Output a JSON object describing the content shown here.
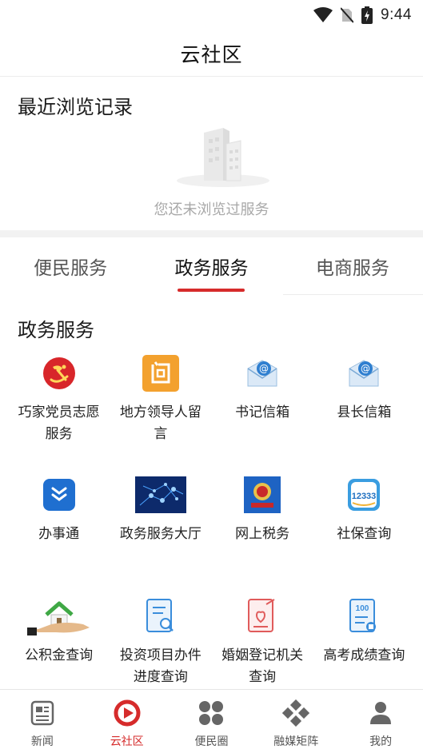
{
  "status_bar": {
    "time": "9:44"
  },
  "header": {
    "title": "云社区"
  },
  "recent": {
    "title": "最近浏览记录",
    "empty_text": "您还未浏览过服务"
  },
  "tabs": [
    {
      "label": "便民服务",
      "active": false
    },
    {
      "label": "政务服务",
      "active": true
    },
    {
      "label": "电商服务",
      "active": false
    }
  ],
  "gov": {
    "title": "政务服务",
    "items": [
      {
        "label": "巧家党员志愿服务",
        "icon": "party-emblem-icon"
      },
      {
        "label": "地方领导人留言",
        "icon": "question-char-icon"
      },
      {
        "label": "书记信箱",
        "icon": "email-envelope-icon"
      },
      {
        "label": "县长信箱",
        "icon": "email-envelope-icon"
      },
      {
        "label": "办事通",
        "icon": "banshitong-logo-icon"
      },
      {
        "label": "政务服务大厅",
        "icon": "network-hall-icon"
      },
      {
        "label": "网上税务",
        "icon": "tax-emblem-icon"
      },
      {
        "label": "社保查询",
        "icon": "social-security-12333-icon"
      },
      {
        "label": "公积金查询",
        "icon": "house-in-hand-icon"
      },
      {
        "label": "投资项目办件进度查询",
        "icon": "document-search-icon"
      },
      {
        "label": "婚姻登记机关查询",
        "icon": "marriage-document-icon"
      },
      {
        "label": "高考成绩查询",
        "icon": "exam-score-100-icon"
      }
    ]
  },
  "bottom_nav": [
    {
      "label": "新闻",
      "icon": "newspaper-icon",
      "active": false
    },
    {
      "label": "云社区",
      "icon": "play-circle-icon",
      "active": true
    },
    {
      "label": "便民圈",
      "icon": "four-petal-icon",
      "active": false
    },
    {
      "label": "融媒矩阵",
      "icon": "diamond-grid-icon",
      "active": false
    },
    {
      "label": "我的",
      "icon": "person-icon",
      "active": false
    }
  ],
  "colors": {
    "accent": "#d62b2b",
    "muted_text": "#a8a8a8",
    "divider": "#f2f2f2"
  }
}
